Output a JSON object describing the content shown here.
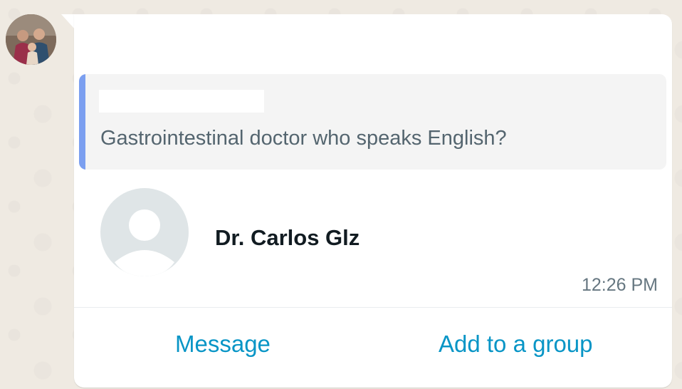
{
  "sender": {
    "avatar_icon": "group-photo-avatar"
  },
  "message": {
    "quoted": {
      "author": "",
      "text": "Gastrointestinal doctor who speaks English?",
      "accent_color": "#7b9ff0"
    },
    "contact_card": {
      "avatar_icon": "default-person-avatar-icon",
      "name": "Dr. Carlos Glz",
      "time": "12:26 PM"
    },
    "actions": {
      "message_label": "Message",
      "add_to_group_label": "Add to a group",
      "color": "#0895c6"
    }
  }
}
